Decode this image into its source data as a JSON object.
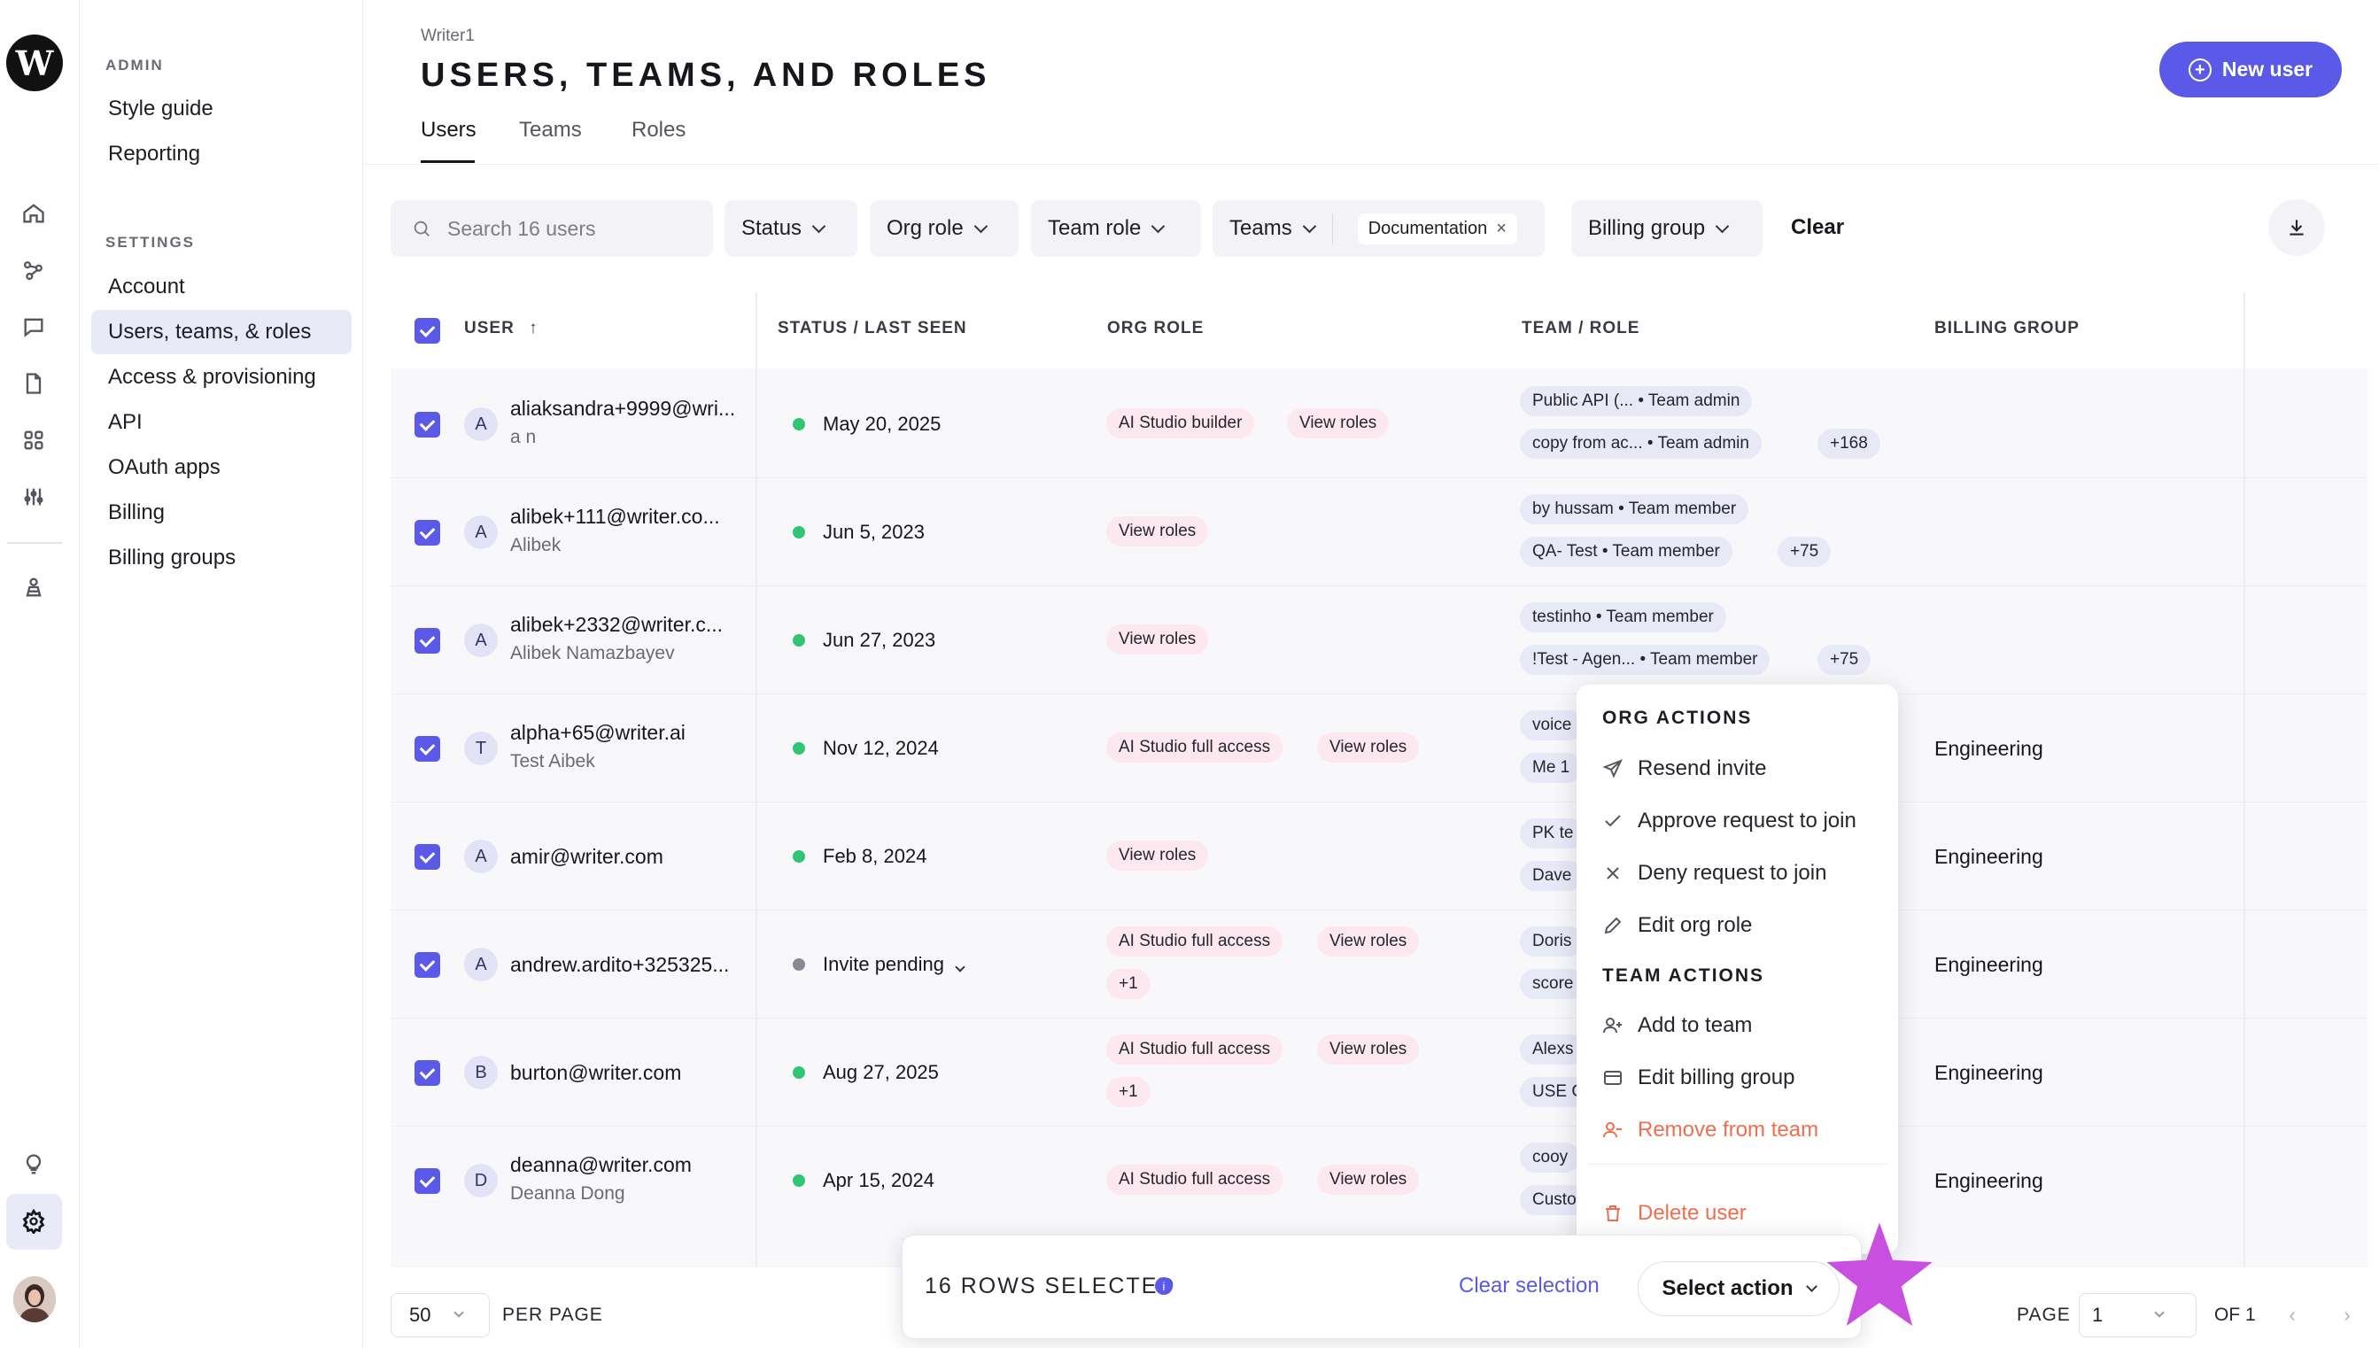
{
  "app": {
    "logo_letter": "W",
    "org_name": "Writer1",
    "page_title": "USERS, TEAMS, AND ROLES"
  },
  "rail": {
    "icons": [
      "home-icon",
      "graph-icon",
      "chat-icon",
      "file-icon",
      "apps-icon",
      "sliders-icon",
      "person-icon",
      "lightbulb-icon",
      "gear-icon"
    ]
  },
  "sidenav": {
    "admin_heading": "ADMIN",
    "admin_items": [
      "Style guide",
      "Reporting"
    ],
    "settings_heading": "SETTINGS",
    "settings_items": [
      "Account",
      "Users, teams, & roles",
      "Access & provisioning",
      "API",
      "OAuth apps",
      "Billing",
      "Billing groups"
    ],
    "active_item": "Users, teams, & roles"
  },
  "header": {
    "new_user_label": "New user",
    "tabs": [
      "Users",
      "Teams",
      "Roles"
    ],
    "active_tab": "Users"
  },
  "filters": {
    "search_placeholder": "Search 16 users",
    "status": "Status",
    "org_role": "Org role",
    "team_role": "Team role",
    "teams": "Teams",
    "teams_chip": "Documentation",
    "billing_group": "Billing group",
    "clear": "Clear"
  },
  "table": {
    "columns": [
      "USER",
      "STATUS / LAST SEEN",
      "ORG ROLE",
      "TEAM / ROLE",
      "BILLING GROUP"
    ],
    "rows": [
      {
        "initial": "A",
        "email": "aliaksandra+9999@wri...",
        "name": "a n",
        "status": "May 20, 2025",
        "org_roles": [
          "AI Studio builder",
          "View roles"
        ],
        "teams": [
          "Public API (... • Team admin",
          "copy from ac... • Team admin"
        ],
        "more": "+168",
        "billing": ""
      },
      {
        "initial": "A",
        "email": "alibek+111@writer.co...",
        "name": "Alibek",
        "status": "Jun 5, 2023",
        "org_roles": [
          "View roles"
        ],
        "teams": [
          "by hussam • Team member",
          "QA- Test • Team member"
        ],
        "more": "+75",
        "billing": ""
      },
      {
        "initial": "A",
        "email": "alibek+2332@writer.c...",
        "name": "Alibek Namazbayev",
        "status": "Jun 27, 2023",
        "org_roles": [
          "View roles"
        ],
        "teams": [
          "testinho • Team member",
          "!Test - Agen... • Team member"
        ],
        "more": "+75",
        "billing": ""
      },
      {
        "initial": "T",
        "email": "alpha+65@writer.ai",
        "name": "Test Aibek",
        "status": "Nov 12, 2024",
        "org_roles": [
          "AI Studio full access",
          "View roles"
        ],
        "teams": [
          "voice",
          "Me 1"
        ],
        "more": "",
        "billing": "Engineering"
      },
      {
        "initial": "A",
        "email": "amir@writer.com",
        "name": "",
        "status": "Feb 8, 2024",
        "org_roles": [
          "View roles"
        ],
        "teams": [
          "PK te",
          "Dave"
        ],
        "more": "",
        "billing": "Engineering"
      },
      {
        "initial": "A",
        "email": "andrew.ardito+325325...",
        "name": "",
        "status": "Invite pending",
        "org_roles": [
          "AI Studio full access",
          "View roles",
          "+1"
        ],
        "teams": [
          "Doris",
          "score"
        ],
        "more": "",
        "billing": "Engineering"
      },
      {
        "initial": "B",
        "email": "burton@writer.com",
        "name": "",
        "status": "Aug 27, 2025",
        "org_roles": [
          "AI Studio full access",
          "View roles",
          "+1"
        ],
        "teams": [
          "Alexs",
          "USE C"
        ],
        "more": "",
        "billing": "Engineering"
      },
      {
        "initial": "D",
        "email": "deanna@writer.com",
        "name": "Deanna Dong",
        "status": "Apr 15, 2024",
        "org_roles": [
          "AI Studio full access",
          "View roles"
        ],
        "teams": [
          "cooy",
          "Custo"
        ],
        "more": "",
        "billing": "Engineering"
      }
    ]
  },
  "menu": {
    "org_heading": "ORG ACTIONS",
    "org_items": [
      {
        "label": "Resend invite",
        "icon": "send-icon"
      },
      {
        "label": "Approve request to join",
        "icon": "check-icon"
      },
      {
        "label": "Deny request to join",
        "icon": "x-icon"
      },
      {
        "label": "Edit org role",
        "icon": "pencil-icon"
      }
    ],
    "team_heading": "TEAM ACTIONS",
    "team_items": [
      {
        "label": "Add to team",
        "icon": "user-plus-icon"
      },
      {
        "label": "Edit billing group",
        "icon": "card-icon"
      },
      {
        "label": "Remove from team",
        "icon": "user-minus-icon"
      }
    ],
    "delete_label": "Delete user",
    "danger_color": "#f26d4d"
  },
  "selection": {
    "count_label": "16 ROWS SELECTED",
    "clear_label": "Clear selection",
    "action_label": "Select action"
  },
  "pagination": {
    "per_page": "50",
    "per_page_label": "PER PAGE",
    "page_label": "PAGE",
    "page": "1",
    "of_label": "OF 1"
  },
  "colors": {
    "accent": "#5b5ae8",
    "status_green": "#2fc574",
    "star": "#c94fe0"
  }
}
